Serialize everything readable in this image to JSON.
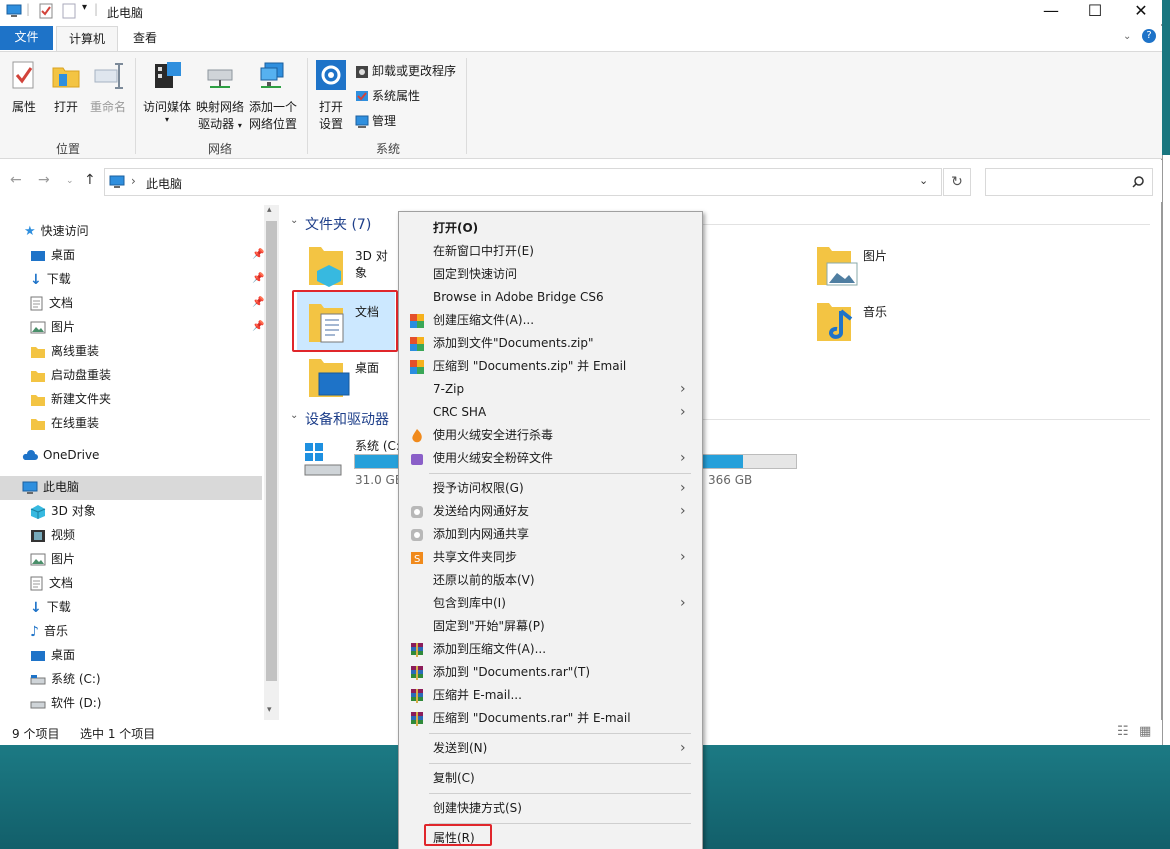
{
  "window": {
    "title": "此电脑",
    "controls": {
      "minimize": "—",
      "maximize": "☐",
      "close": "✕"
    }
  },
  "tabs": {
    "file": "文件",
    "computer": "计算机",
    "view": "查看"
  },
  "ribbon": {
    "location": {
      "properties": "属性",
      "open": "打开",
      "rename": "重命名",
      "group": "位置"
    },
    "network": {
      "access_media": "访问媒体",
      "map_drive_1": "映射网络",
      "map_drive_2": "驱动器",
      "add_location_1": "添加一个",
      "add_location_2": "网络位置",
      "group": "网络"
    },
    "system": {
      "open_settings_1": "打开",
      "open_settings_2": "设置",
      "uninstall": "卸载或更改程序",
      "sys_props": "系统属性",
      "manage": "管理",
      "group": "系统"
    }
  },
  "address": {
    "path": "此电脑",
    "separator": "›"
  },
  "nav": {
    "quick_access": "快速访问",
    "desktop": "桌面",
    "downloads": "下载",
    "documents": "文档",
    "pictures": "图片",
    "f1": "离线重装",
    "f2": "启动盘重装",
    "f3": "新建文件夹",
    "f4": "在线重装",
    "onedrive": "OneDrive",
    "this_pc": "此电脑",
    "pc_3d": "3D 对象",
    "pc_video": "视频",
    "pc_pictures": "图片",
    "pc_documents": "文档",
    "pc_downloads": "下载",
    "pc_music": "音乐",
    "pc_desktop": "桌面",
    "drive_c": "系统 (C:)",
    "drive_d": "软件 (D:)"
  },
  "content": {
    "folders_header": "文件夹 (7)",
    "f_3d": "3D 对象",
    "f_pictures": "图片",
    "f_documents": "文档",
    "f_music": "音乐",
    "f_desktop": "桌面",
    "devices_header": "设备和驱动器",
    "drive_c_name": "系统 (C:",
    "drive_c_free": "31.0 GB",
    "drive_c_total_tail": "366 GB",
    "drive_c_used_fraction": 0.88
  },
  "status": {
    "count": "9 个项目",
    "selected": "选中 1 个项目"
  },
  "context_menu": {
    "open": "打开(O)",
    "open_new_window": "在新窗口中打开(E)",
    "pin_quick": "固定到快速访问",
    "bridge": "Browse in Adobe Bridge CS6",
    "create_archive": "创建压缩文件(A)...",
    "add_zip": "添加到文件\"Documents.zip\"",
    "zip_email": "压缩到 \"Documents.zip\" 并 Email",
    "sevenzip": "7-Zip",
    "crc": "CRC SHA",
    "scan": "使用火绒安全进行杀毒",
    "shred": "使用火绒安全粉碎文件",
    "grant": "授予访问权限(G)",
    "send_lan": "发送给内网通好友",
    "add_lan_share": "添加到内网通共享",
    "share_sync": "共享文件夹同步",
    "restore": "还原以前的版本(V)",
    "include_lib": "包含到库中(I)",
    "pin_start": "固定到\"开始\"屏幕(P)",
    "rar_add": "添加到压缩文件(A)...",
    "rar_add_named": "添加到 \"Documents.rar\"(T)",
    "rar_email": "压缩并 E-mail...",
    "rar_named_email": "压缩到 \"Documents.rar\" 并 E-mail",
    "send_to": "发送到(N)",
    "copy": "复制(C)",
    "shortcut": "创建快捷方式(S)",
    "properties": "属性(R)"
  },
  "colors": {
    "accent": "#1e73c8",
    "highlight": "#e0262b",
    "drive_bar": "#26a0da"
  }
}
